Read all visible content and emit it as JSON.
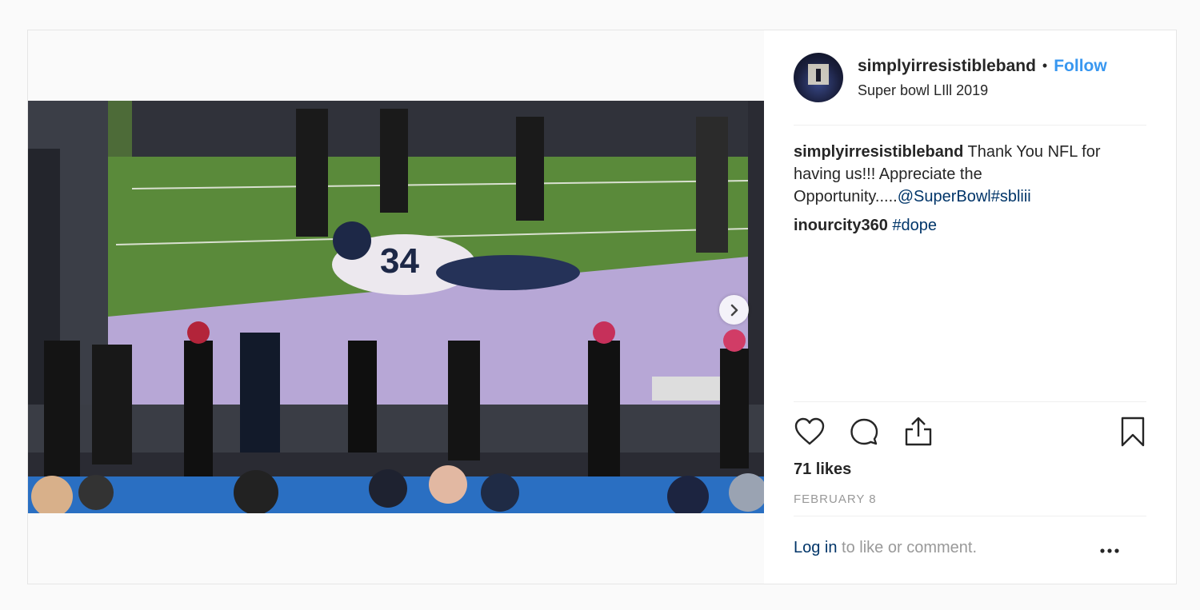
{
  "post": {
    "username": "simplyirresistibleband",
    "follow_label": "Follow",
    "location": "Super bowl LIll 2019",
    "caption_username": "simplyirresistibleband",
    "caption_text": " Thank You NFL for having us!!! Appreciate the Opportunity.....",
    "caption_mention": "@SuperBowl",
    "caption_hashtag": "#sbliii",
    "comment_username": "inourcity360",
    "comment_hashtag": "#dope",
    "likes": "71 likes",
    "date": "FEBRUARY 8",
    "login_link": "Log in",
    "login_suffix": " to like or comment."
  },
  "icons": {
    "like": "heart-icon",
    "comment": "comment-icon",
    "share": "share-icon",
    "save": "bookmark-icon",
    "next": "chevron-right-icon",
    "more": "more-options-icon"
  },
  "colors": {
    "link_blue": "#3897f0",
    "tag_blue": "#003569",
    "text": "#262626",
    "muted": "#999999"
  }
}
